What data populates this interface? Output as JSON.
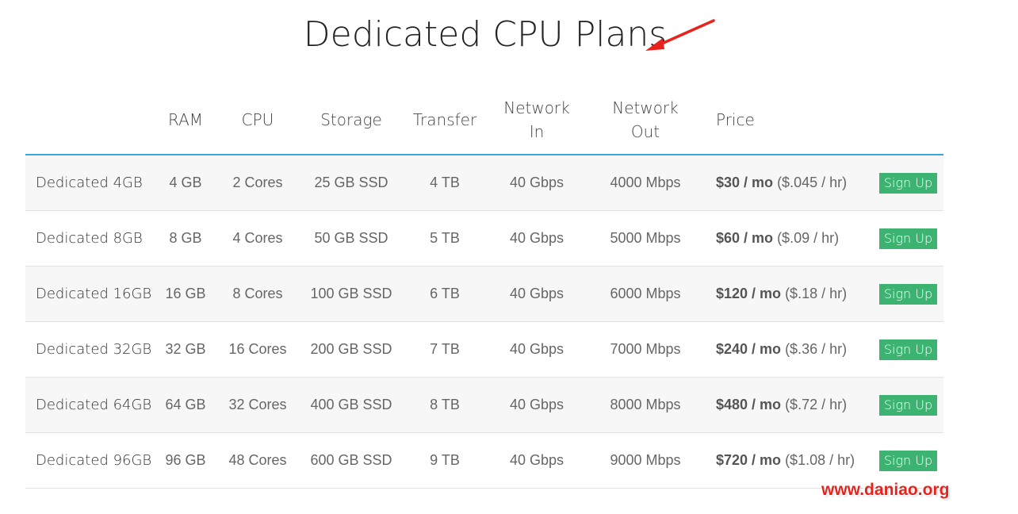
{
  "page": {
    "title": "Dedicated CPU Plans",
    "watermark": "www.daniao.org"
  },
  "colors": {
    "accent_line": "#3aa8d8",
    "signup_button": "#3cb371",
    "annotation_arrow": "#e8231c",
    "watermark": "#e8231c"
  },
  "table": {
    "headers": {
      "plan": "",
      "ram": "RAM",
      "cpu": "CPU",
      "storage": "Storage",
      "transfer": "Transfer",
      "network_in_1": "Network",
      "network_in_2": "In",
      "network_out_1": "Network",
      "network_out_2": "Out",
      "price": "Price",
      "action": ""
    },
    "rows": [
      {
        "name": "Dedicated 4GB",
        "ram": "4 GB",
        "cpu": "2 Cores",
        "storage": "25 GB SSD",
        "transfer": "4 TB",
        "network_in": "40 Gbps",
        "network_out": "4000 Mbps",
        "price_mo": "$30 / mo",
        "price_hr": "($.045 / hr)",
        "action": "Sign Up"
      },
      {
        "name": "Dedicated 8GB",
        "ram": "8 GB",
        "cpu": "4 Cores",
        "storage": "50 GB SSD",
        "transfer": "5 TB",
        "network_in": "40 Gbps",
        "network_out": "5000 Mbps",
        "price_mo": "$60 / mo",
        "price_hr": "($.09 / hr)",
        "action": "Sign Up"
      },
      {
        "name": "Dedicated 16GB",
        "ram": "16 GB",
        "cpu": "8 Cores",
        "storage": "100 GB SSD",
        "transfer": "6 TB",
        "network_in": "40 Gbps",
        "network_out": "6000 Mbps",
        "price_mo": "$120 / mo",
        "price_hr": "($.18 / hr)",
        "action": "Sign Up"
      },
      {
        "name": "Dedicated 32GB",
        "ram": "32 GB",
        "cpu": "16 Cores",
        "storage": "200 GB SSD",
        "transfer": "7 TB",
        "network_in": "40 Gbps",
        "network_out": "7000 Mbps",
        "price_mo": "$240 / mo",
        "price_hr": "($.36 / hr)",
        "action": "Sign Up"
      },
      {
        "name": "Dedicated 64GB",
        "ram": "64 GB",
        "cpu": "32 Cores",
        "storage": "400 GB SSD",
        "transfer": "8 TB",
        "network_in": "40 Gbps",
        "network_out": "8000 Mbps",
        "price_mo": "$480 / mo",
        "price_hr": "($.72 / hr)",
        "action": "Sign Up"
      },
      {
        "name": "Dedicated 96GB",
        "ram": "96 GB",
        "cpu": "48 Cores",
        "storage": "600 GB SSD",
        "transfer": "9 TB",
        "network_in": "40 Gbps",
        "network_out": "9000 Mbps",
        "price_mo": "$720 / mo",
        "price_hr": "($1.08 / hr)",
        "action": "Sign Up"
      }
    ]
  }
}
